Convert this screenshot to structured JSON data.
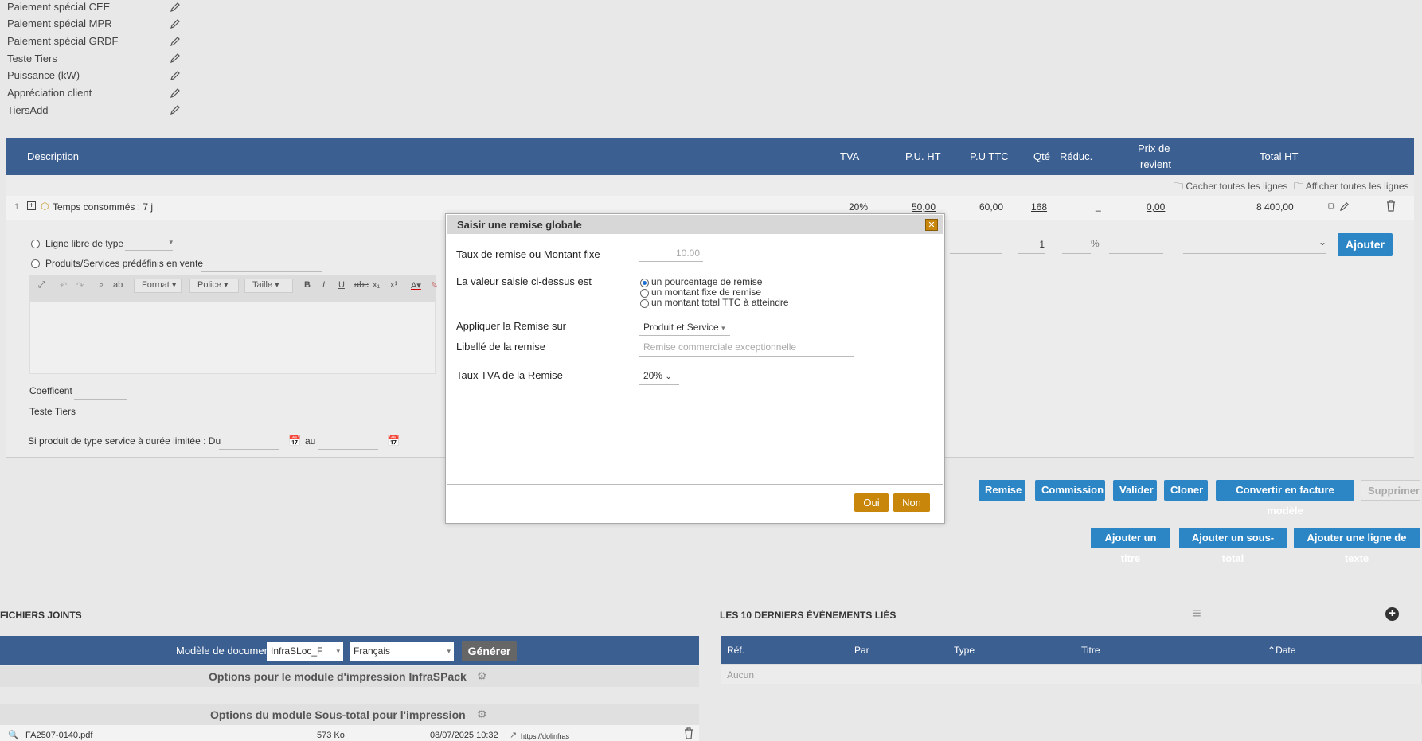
{
  "extrafields": [
    {
      "label": "Paiement spécial CEE"
    },
    {
      "label": "Paiement spécial MPR"
    },
    {
      "label": "Paiement spécial GRDF"
    },
    {
      "label": "Teste Tiers"
    },
    {
      "label": "Puissance (kW)"
    },
    {
      "label": "Appréciation client"
    },
    {
      "label": "TiersAdd"
    }
  ],
  "table_header": {
    "description": "Description",
    "tva": "TVA",
    "pu_ht": "P.U. HT",
    "pu_ttc": "P.U TTC",
    "qte": "Qté",
    "reduc": "Réduc.",
    "prix_revient_1": "Prix de",
    "prix_revient_2": "revient",
    "total_ht": "Total HT"
  },
  "line_toggles": {
    "hide": "Cacher toutes les lignes",
    "show": "Afficher toutes les lignes"
  },
  "line": {
    "num": "1",
    "label": "Temps consommés : 7 j",
    "tva": "20%",
    "pu_ht": "50,00",
    "pu_ttc": "60,00",
    "qte": "168",
    "reduc": "_",
    "prix_revient": "0,00",
    "total_ht": "8 400,00"
  },
  "add_line": {
    "free_line_label": "Ligne libre de type",
    "predefined_label": "Produits/Services prédéfinis en vente",
    "toolbar": {
      "format": "Format",
      "police": "Police",
      "taille": "Taille"
    },
    "coef_label": "Coefficent",
    "teste_tiers_label": "Teste Tiers",
    "service_dates_label": "Si produit de type service à durée limitée : Du",
    "au_label": "au",
    "qty_value": "1",
    "percent": "%",
    "add_button": "Ajouter"
  },
  "modal": {
    "title": "Saisir une remise globale",
    "taux_label": "Taux de remise ou Montant fixe",
    "taux_placeholder": "10.00",
    "valeur_label": "La valeur saisie ci-dessus est",
    "options": [
      "un pourcentage de remise",
      "un montant fixe de remise",
      "un montant total TTC à atteindre"
    ],
    "appliquer_label": "Appliquer la Remise sur",
    "appliquer_value": "Produit et Service",
    "libelle_label": "Libellé de la remise",
    "libelle_placeholder": "Remise commerciale exceptionnelle",
    "tva_label": "Taux TVA de la Remise",
    "tva_value": "20%",
    "oui": "Oui",
    "non": "Non"
  },
  "actions": {
    "remise": "Remise",
    "commission": "Commission",
    "valider": "Valider",
    "cloner": "Cloner",
    "convertir": "Convertir en facture modèle",
    "supprimer": "Supprimer",
    "ajouter_titre": "Ajouter un titre",
    "ajouter_sous_total": "Ajouter un sous-total",
    "ajouter_ligne_texte": "Ajouter une ligne de texte"
  },
  "files": {
    "section_title": "FICHIERS JOINTS",
    "modele_label": "Modèle de document",
    "modele_value": "InfraSLoc_F",
    "lang_value": "Français",
    "generate": "Générer",
    "opt1": "Options pour le module d'impression InfraSPack",
    "opt2": "Options du module Sous-total pour l'impression",
    "file_name": "FA2507-0140.pdf",
    "file_size": "573 Ko",
    "file_date": "08/07/2025 10:32",
    "file_link": "https://dolinfras"
  },
  "events": {
    "section_title": "LES 10 DERNIERS ÉVÉNEMENTS LIÉS",
    "col_ref": "Réf.",
    "col_par": "Par",
    "col_type": "Type",
    "col_titre": "Titre",
    "col_date": "Date",
    "empty": "Aucun"
  },
  "colors": {
    "header": "#3c5f91",
    "button": "#2c85c5",
    "modal_button": "#c8860a"
  }
}
